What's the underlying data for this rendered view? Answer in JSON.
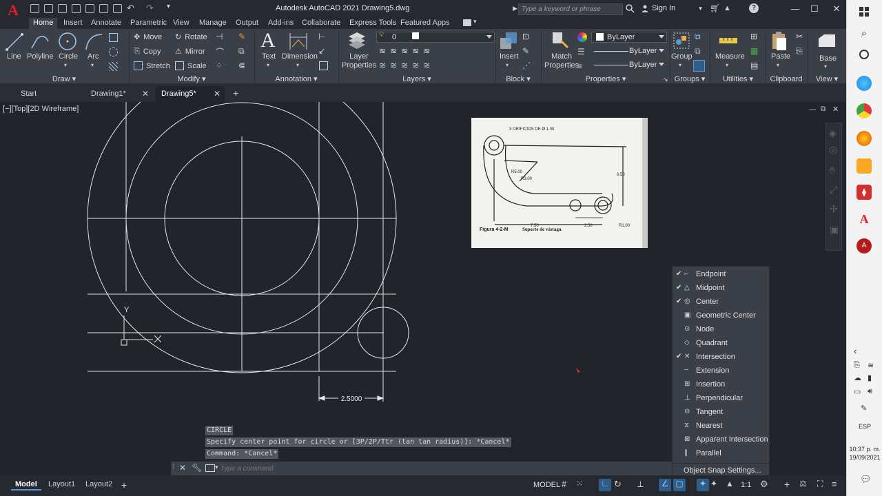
{
  "window": {
    "title": "Autodesk AutoCAD 2021   Drawing5.dwg",
    "search_placeholder": "Type a keyword or phrase",
    "signin": "Sign In"
  },
  "ribbon_tabs": [
    "Home",
    "Insert",
    "Annotate",
    "Parametric",
    "View",
    "Manage",
    "Output",
    "Add-ins",
    "Collaborate",
    "Express Tools",
    "Featured Apps"
  ],
  "ribbon": {
    "draw": {
      "title": "Draw",
      "line": "Line",
      "polyline": "Polyline",
      "circle": "Circle",
      "arc": "Arc"
    },
    "modify": {
      "title": "Modify",
      "move": "Move",
      "rotate": "Rotate",
      "copy": "Copy",
      "mirror": "Mirror",
      "stretch": "Stretch",
      "scale": "Scale"
    },
    "annotation": {
      "title": "Annotation",
      "text": "Text",
      "dimension": "Dimension"
    },
    "layers": {
      "title": "Layers",
      "layer_properties": "Layer Properties",
      "current_layer": "0"
    },
    "block": {
      "title": "Block",
      "insert": "Insert"
    },
    "properties": {
      "title": "Properties",
      "match": "Match Properties",
      "color": "ByLayer",
      "linetype": "ByLayer",
      "lineweight": "ByLayer"
    },
    "groups": {
      "title": "Groups",
      "group": "Group"
    },
    "utilities": {
      "title": "Utilities",
      "measure": "Measure"
    },
    "clipboard": {
      "title": "Clipboard",
      "paste": "Paste"
    },
    "view": {
      "title": "View",
      "base": "Base"
    }
  },
  "file_tabs": [
    "Start",
    "Drawing1*",
    "Drawing5*"
  ],
  "viewport_label": "[−][Top][2D Wireframe]",
  "dimension_text": "2.5000",
  "ucs": {
    "y": "Y"
  },
  "reference_image": {
    "caption_left": "Figura 4-2-M",
    "caption_right": "Soporte de vástago.",
    "note_holes": "3 ORIFICIOS DE Ø 1.00",
    "r5": "R5.00",
    "r3": "R3.00",
    "d650": "6.50",
    "d750": "7.50",
    "d250": "2.50",
    "r100": "R1.00"
  },
  "command_history": [
    "CIRCLE",
    "Specify center point for circle or [3P/2P/Ttr (tan tan radius)]: *Cancel*",
    "Command: *Cancel*"
  ],
  "command_placeholder": "Type a command",
  "osnap_menu": {
    "items": [
      {
        "label": "Endpoint",
        "checked": true,
        "icon": "endpoint-icon"
      },
      {
        "label": "Midpoint",
        "checked": true,
        "icon": "midpoint-icon"
      },
      {
        "label": "Center",
        "checked": true,
        "icon": "center-icon"
      },
      {
        "label": "Geometric Center",
        "checked": false,
        "icon": "geometric-center-icon"
      },
      {
        "label": "Node",
        "checked": false,
        "icon": "node-icon"
      },
      {
        "label": "Quadrant",
        "checked": false,
        "icon": "quadrant-icon"
      },
      {
        "label": "Intersection",
        "checked": true,
        "icon": "intersection-icon"
      },
      {
        "label": "Extension",
        "checked": false,
        "icon": "extension-icon"
      },
      {
        "label": "Insertion",
        "checked": false,
        "icon": "insertion-icon"
      },
      {
        "label": "Perpendicular",
        "checked": false,
        "icon": "perpendicular-icon"
      },
      {
        "label": "Tangent",
        "checked": false,
        "icon": "tangent-icon"
      },
      {
        "label": "Nearest",
        "checked": false,
        "icon": "nearest-icon"
      },
      {
        "label": "Apparent Intersection",
        "checked": false,
        "icon": "apparent-intersection-icon"
      },
      {
        "label": "Parallel",
        "checked": false,
        "icon": "parallel-icon"
      }
    ],
    "settings": "Object Snap Settings..."
  },
  "layout_tabs": [
    "Model",
    "Layout1",
    "Layout2"
  ],
  "status": {
    "model": "MODEL",
    "scale": "1:1"
  },
  "taskbar": {
    "lang": "ESP",
    "time": "10:37 p. m.",
    "date": "19/09/2021"
  },
  "colors": {
    "accent": "#2f5e8a",
    "autocad_red": "#e51c23",
    "drawing_bg": "#21252b",
    "ribbon_bg": "#3b4048"
  }
}
